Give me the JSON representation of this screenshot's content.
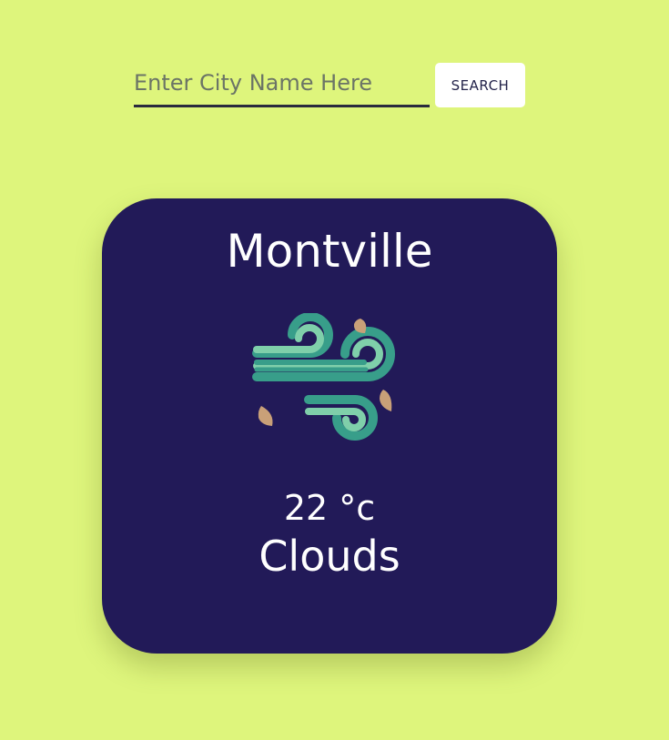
{
  "search": {
    "placeholder": "Enter City Name Here",
    "value": "",
    "button_label": "SEARCH"
  },
  "weather": {
    "city": "Montville",
    "temperature": "22 °c",
    "condition": "Clouds",
    "icon": "wind-icon"
  },
  "colors": {
    "page_background": "#def57c",
    "card_background": "#221a58",
    "card_text": "#ffffff",
    "icon_teal_dark": "#389e8a",
    "icon_teal_light": "#7fcfaa",
    "icon_leaf": "#c9a078"
  }
}
